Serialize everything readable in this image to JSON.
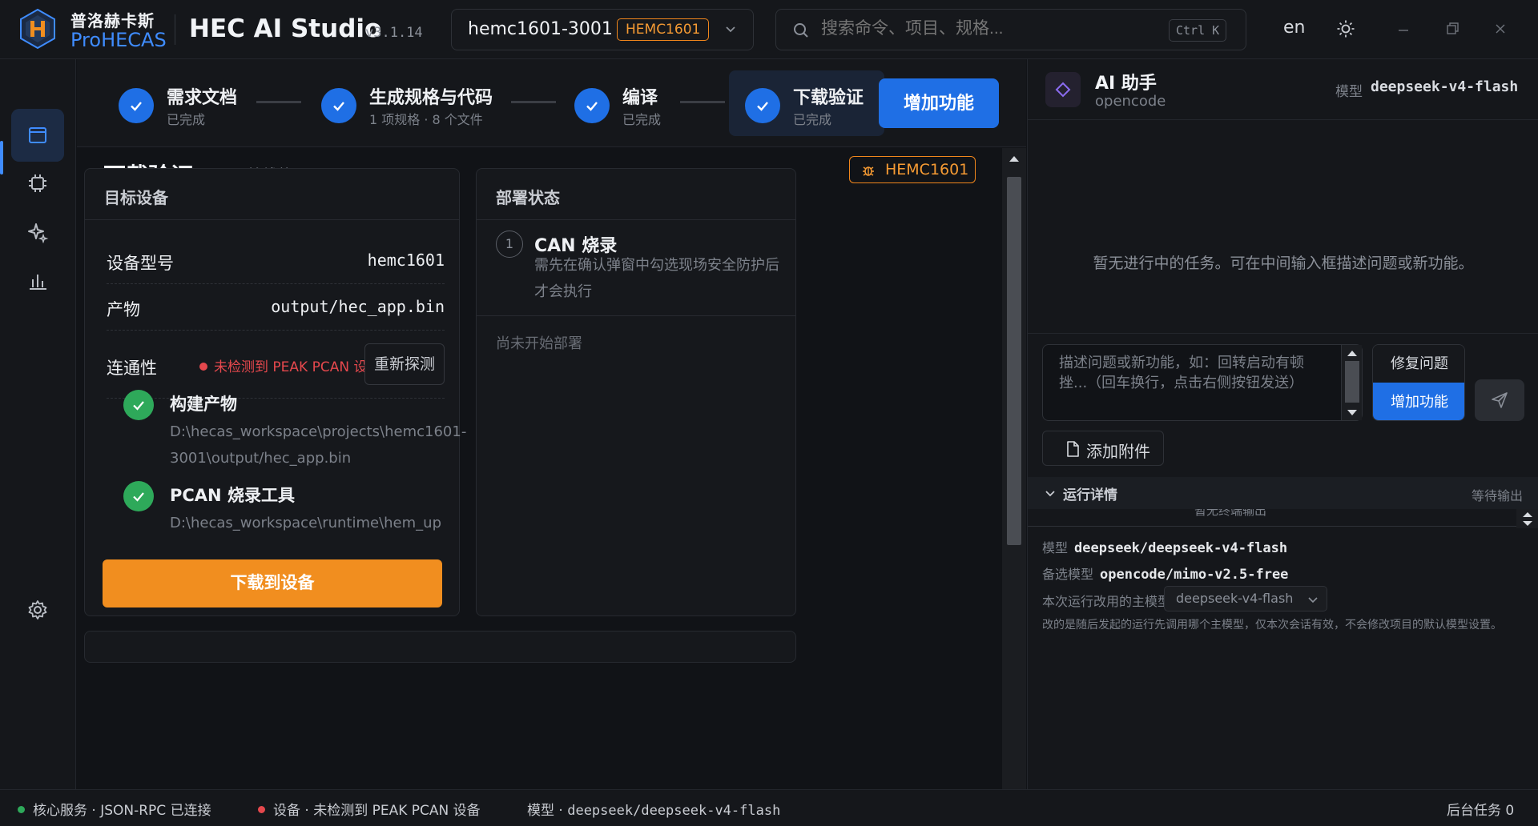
{
  "titlebar": {
    "brand_cn": "普洛赫卡斯",
    "brand_en": "ProHECAS",
    "app_title": "HEC AI Studio",
    "version": "v3.1.14",
    "project_name": "hemc1601-3001",
    "project_badge": "HEMC1601",
    "search_placeholder": "搜索命令、项目、规格...",
    "search_shortcut": "Ctrl K",
    "language": "en"
  },
  "rail": {
    "items": [
      "home-icon",
      "window-icon",
      "chip-icon",
      "sparkle-icon",
      "bar-chart-icon",
      "gear-icon"
    ],
    "active_index": 1
  },
  "stepper": {
    "steps": [
      {
        "title": "需求文档",
        "subtitle": "已完成"
      },
      {
        "title": "生成规格与代码",
        "subtitle": "1 项规格 · 8 个文件"
      },
      {
        "title": "编译",
        "subtitle": "已完成"
      },
      {
        "title": "下载验证",
        "subtitle": "已完成"
      }
    ],
    "add_feature_label": "增加功能"
  },
  "main": {
    "title": "下载验证",
    "subtitle": "CAN 总线烧录",
    "badge": "HEMC1601",
    "target": {
      "header": "目标设备",
      "model_label": "设备型号",
      "model_value": "hemc1601",
      "artifact_label": "产物",
      "artifact_value": "output/hec_app.bin",
      "conn_label": "连通性",
      "conn_status": "未检测到 PEAK PCAN 设备",
      "reprobe_label": "重新探测",
      "checks": [
        {
          "title": "构建产物",
          "path_line1": "D:\\hecas_workspace\\projects\\hemc1601-",
          "path_line2": "3001\\output/hec_app.bin"
        },
        {
          "title": "PCAN 烧录工具",
          "path_line1": "D:\\hecas_workspace\\runtime\\hem_upgrade\\hem_up",
          "path_line2": ""
        }
      ],
      "download_label": "下载到设备"
    },
    "deploy": {
      "header": "部署状态",
      "step_number": "1",
      "step_title": "CAN 烧录",
      "step_desc": "需先在确认弹窗中勾选现场安全防护后才会执行",
      "empty_text": "尚未开始部署"
    }
  },
  "ai": {
    "title": "AI 助手",
    "subtitle": "opencode",
    "model_label": "模型",
    "model_value": "deepseek-v4-flash",
    "empty_text": "暂无进行中的任务。可在中间输入框描述问题或新功能。",
    "input_placeholder": "描述问题或新功能，如：回转启动有顿挫...（回车换行，点击右侧按钮发送）",
    "mode_fix": "修复问题",
    "mode_add": "增加功能",
    "attach_label": "添加附件",
    "run": {
      "title": "运行详情",
      "status": "等待输出",
      "peek_text": "暂无终端输出",
      "model_label": "模型",
      "model_value": "deepseek/deepseek-v4-flash",
      "backup_label": "备选模型",
      "backup_value": "opencode/mimo-v2.5-free",
      "override_label": "本次运行改用的主模型",
      "override_value": "deepseek-v4-flash",
      "note": "改的是随后发起的运行先调用哪个主模型，仅本次会话有效，不会修改项目的默认模型设置。"
    }
  },
  "statusbar": {
    "core": "核心服务 · JSON-RPC 已连接",
    "device": "设备 · 未检测到 PEAK PCAN 设备",
    "model_label": "模型 ·",
    "model_value": "deepseek/deepseek-v4-flash",
    "tasks": "后台任务 0"
  },
  "colors": {
    "accent": "#1f6fe5",
    "warning": "#f18e1f",
    "error": "#e5484d",
    "success": "#2ea95a"
  }
}
